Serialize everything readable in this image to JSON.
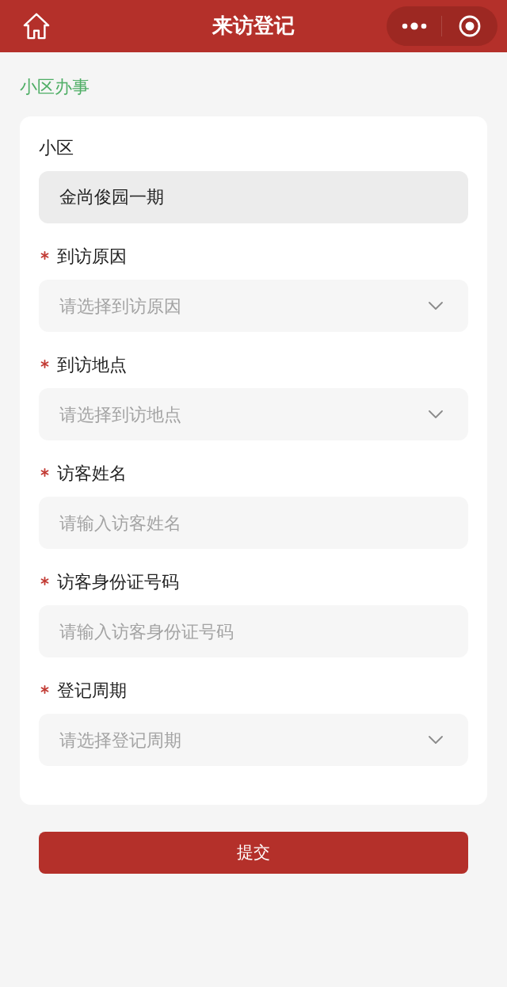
{
  "header": {
    "title": "来访登记"
  },
  "breadcrumb": "小区办事",
  "fields": [
    {
      "kind": "readonly",
      "label": "小区",
      "required": false,
      "value": "金尚俊园一期"
    },
    {
      "kind": "select",
      "label": "到访原因",
      "required": true,
      "placeholder": "请选择到访原因"
    },
    {
      "kind": "select",
      "label": "到访地点",
      "required": true,
      "placeholder": "请选择到访地点"
    },
    {
      "kind": "text",
      "label": "访客姓名",
      "required": true,
      "placeholder": "请输入访客姓名"
    },
    {
      "kind": "text",
      "label": "访客身份证号码",
      "required": true,
      "placeholder": "请输入访客身份证号码"
    },
    {
      "kind": "select",
      "label": "登记周期",
      "required": true,
      "placeholder": "请选择登记周期"
    }
  ],
  "submit": "提交"
}
